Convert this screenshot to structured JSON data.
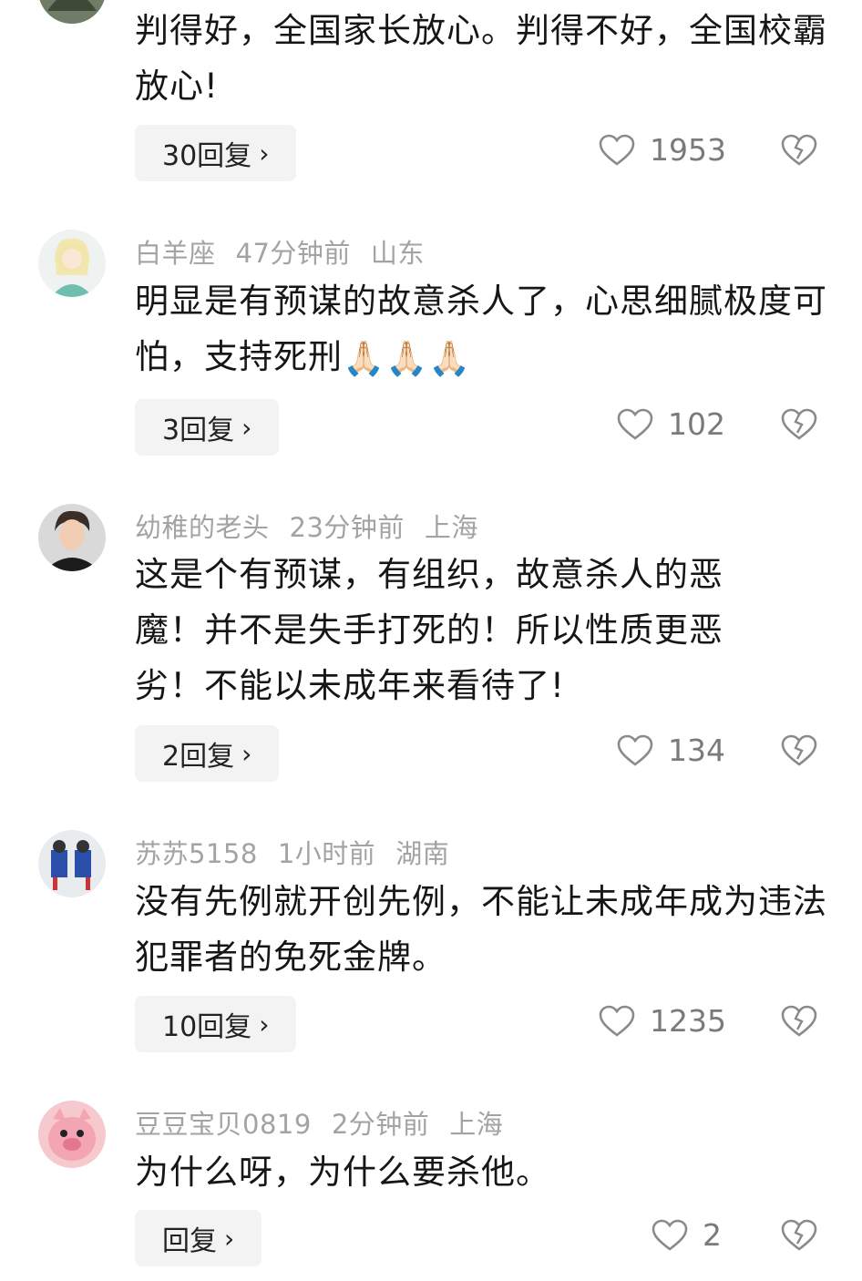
{
  "colors": {
    "text_main": "#161616",
    "text_meta": "#a3a3a3",
    "count": "#7a7a7a",
    "button_bg": "#f3f3f3"
  },
  "icons": {
    "like": "heart-outline-icon",
    "dislike": "broken-heart-icon",
    "chevron": "chevron-right-icon"
  },
  "comments": [
    {
      "user": "",
      "time": "",
      "location": "",
      "text": "判得好，全国家长放心。判得不好，全国校霸放心!",
      "replies": "30回复",
      "likes": "1953"
    },
    {
      "user": "白羊座",
      "time": "47分钟前",
      "location": "山东",
      "text": "明显是有预谋的故意杀人了，心思细腻极度可怕，支持死刑",
      "emoji": "🙏🏻🙏🏻🙏🏻",
      "replies": "3回复",
      "likes": "102"
    },
    {
      "user": "幼稚的老头",
      "time": "23分钟前",
      "location": "上海",
      "text": "这是个有预谋，有组织，故意杀人的恶魔！并不是失手打死的！所以性质更恶劣！不能以未成年来看待了!",
      "replies": "2回复",
      "likes": "134"
    },
    {
      "user": "苏苏5158",
      "time": "1小时前",
      "location": "湖南",
      "text": "没有先例就开创先例，不能让未成年成为违法犯罪者的免死金牌。",
      "replies": "10回复",
      "likes": "1235"
    },
    {
      "user": "豆豆宝贝0819",
      "time": "2分钟前",
      "location": "上海",
      "text": "为什么呀，为什么要杀他。",
      "replies": "回复",
      "likes": "2"
    }
  ]
}
